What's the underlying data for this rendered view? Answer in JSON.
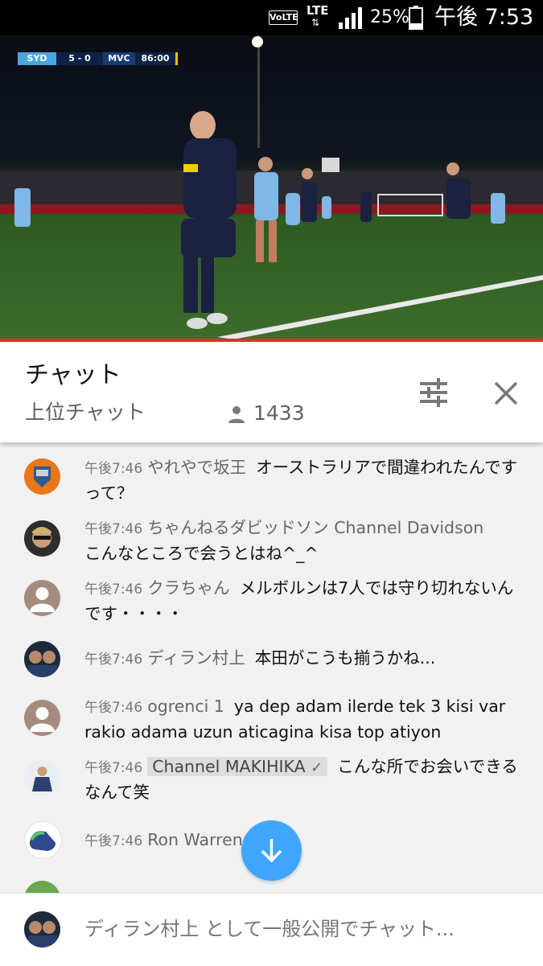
{
  "status_bar": {
    "volte": "VoLTE",
    "network": "LTE",
    "network_arrows": "⇅",
    "battery": "25%",
    "time": "午後 7:53"
  },
  "video": {
    "home": "SYD",
    "score": "5 - 0",
    "away": "MVC",
    "clock": "86:00"
  },
  "chat": {
    "title": "チャット",
    "mode": "上位チャット",
    "viewers": "1433",
    "input_placeholder": "ディラン村上 として一般公開でチャット..."
  },
  "messages": [
    {
      "time": "午後7:46",
      "author": "やれやで坂王",
      "text": "オーストラリアで間違われたんですって？",
      "avatar": "badge-avatar",
      "owner": false
    },
    {
      "time": "午後7:46",
      "author": "ちゃんねるダビッドソン Channel Davidson",
      "text": "こんなところで会うとはね^_^",
      "avatar": "man-sunglasses-avatar",
      "owner": false
    },
    {
      "time": "午後7:46",
      "author": "クラちゃん",
      "text": "メルボルンは7人では守り切れないんです・・・・",
      "avatar": "default-avatar",
      "owner": false
    },
    {
      "time": "午後7:46",
      "author": "ディラン村上",
      "text": "本田がこうも揃うかね...",
      "avatar": "dylan-avatar",
      "owner": false
    },
    {
      "time": "午後7:46",
      "author": "ogrenci 1",
      "text": "ya dep adam ilerde tek 3 kisi var rakio adama uzun aticagina kisa top atiyon",
      "avatar": "default-avatar",
      "owner": false
    },
    {
      "time": "午後7:46",
      "author": "Channel MAKIHIKA",
      "verified": "✓",
      "text": "こんな所でお会いできるなんて笑",
      "avatar": "suit-avatar",
      "owner": true
    },
    {
      "time": "午後7:46",
      "author": "Ron Warren",
      "text": "?",
      "avatar": "shoe-avatar",
      "owner": false
    }
  ],
  "colors": {
    "accent_red": "#e52d27",
    "fab_blue": "#3ea6ff"
  }
}
